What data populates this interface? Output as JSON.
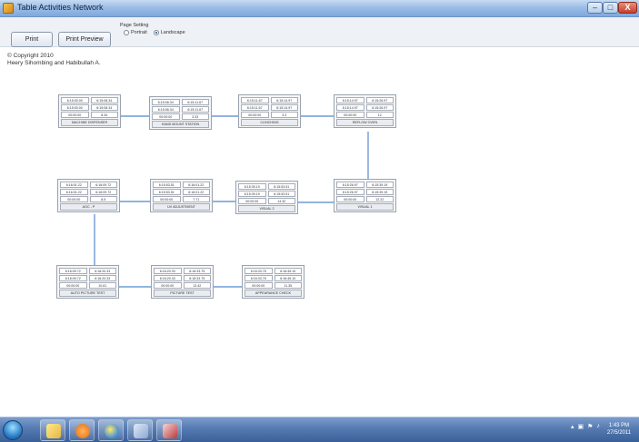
{
  "window": {
    "title": "Table Activities Network",
    "min_label": "–",
    "max_label": "□",
    "close_label": "X"
  },
  "toolbar": {
    "print_label": "Print",
    "preview_label": "Print Preview",
    "page_setting_label": "Page Setting",
    "portrait_label": "Portrait",
    "landscape_label": "Landscape",
    "orientation_selected": "Landscape"
  },
  "copyright": {
    "line1": "© Copyright 2010",
    "line2": "Heery Sihombing and Habibullah A."
  },
  "nodes": [
    {
      "label": "MACHINE DISPENSER",
      "r1": [
        "6:15:00.00",
        "6:15:08.34"
      ],
      "r2": [
        "6:15:00.00",
        "6:15:08.34"
      ],
      "r3": [
        "00:00:00",
        "8.34"
      ]
    },
    {
      "label": "HAND MOUNT STATION",
      "r1": [
        "6:15:08.34",
        "6:15:11.67"
      ],
      "r2": [
        "6:15:08.34",
        "6:15:11.67"
      ],
      "r3": [
        "00:00:00",
        "3.33"
      ]
    },
    {
      "label": "CLINCHING",
      "r1": [
        "6:15:11.67",
        "6:15:14.97"
      ],
      "r2": [
        "6:15:11.67",
        "6:15:14.97"
      ],
      "r3": [
        "00:00:00",
        "3.3"
      ]
    },
    {
      "label": "REFLOW OVEN",
      "r1": [
        "6:15:14.97",
        "6:15:26.97"
      ],
      "r2": [
        "6:15:14.97",
        "6:15:26.97"
      ],
      "r3": [
        "00:00:00",
        "12"
      ]
    },
    {
      "label": "AGC - P",
      "r1": [
        "6:16:01.22",
        "6:16:09.72"
      ],
      "r2": [
        "6:16:01.22",
        "6:16:09.72"
      ],
      "r3": [
        "00:00:00",
        "8.5"
      ]
    },
    {
      "label": "UV ADJUSTMENT",
      "r1": [
        "6:15:53.51",
        "6:16:01.22"
      ],
      "r2": [
        "6:15:53.51",
        "6:16:01.22"
      ],
      "r3": [
        "00:00:00",
        "7.71"
      ]
    },
    {
      "label": "VISUAL 2",
      "r1": [
        "6:15:39.19",
        "6:15:53.51"
      ],
      "r2": [
        "6:15:39.19",
        "6:15:53.51"
      ],
      "r3": [
        "00:00:00",
        "14.32"
      ]
    },
    {
      "label": "VISUAL 1",
      "r1": [
        "6:15:26.97",
        "6:15:39.19"
      ],
      "r2": [
        "6:15:26.97",
        "6:15:39.19"
      ],
      "r3": [
        "00:00:00",
        "12.22"
      ]
    },
    {
      "label": "AUTO PICTURE TEST",
      "r1": [
        "6:16:09.72",
        "6:16:20.33"
      ],
      "r2": [
        "6:16:09.72",
        "6:16:20.33"
      ],
      "r3": [
        "00:00:00",
        "10.61"
      ]
    },
    {
      "label": "PICTURE TEST",
      "r1": [
        "6:16:20.33",
        "6:16:33.75"
      ],
      "r2": [
        "6:16:20.33",
        "6:16:33.75"
      ],
      "r3": [
        "00:00:00",
        "13.42"
      ]
    },
    {
      "label": "APPEARANCE CHECK",
      "r1": [
        "6:16:33.75",
        "6:16:45.10"
      ],
      "r2": [
        "6:16:33.75",
        "6:16:45.10"
      ],
      "r3": [
        "00:00:00",
        "11.35"
      ]
    }
  ],
  "taskbar": {
    "clock_time": "1:43 PM",
    "clock_date": "27/5/2011",
    "items": [
      "start-orb",
      "explorer-icon",
      "media-player-icon",
      "internet-explorer-icon",
      "app-icon",
      "viewer-icon"
    ]
  }
}
